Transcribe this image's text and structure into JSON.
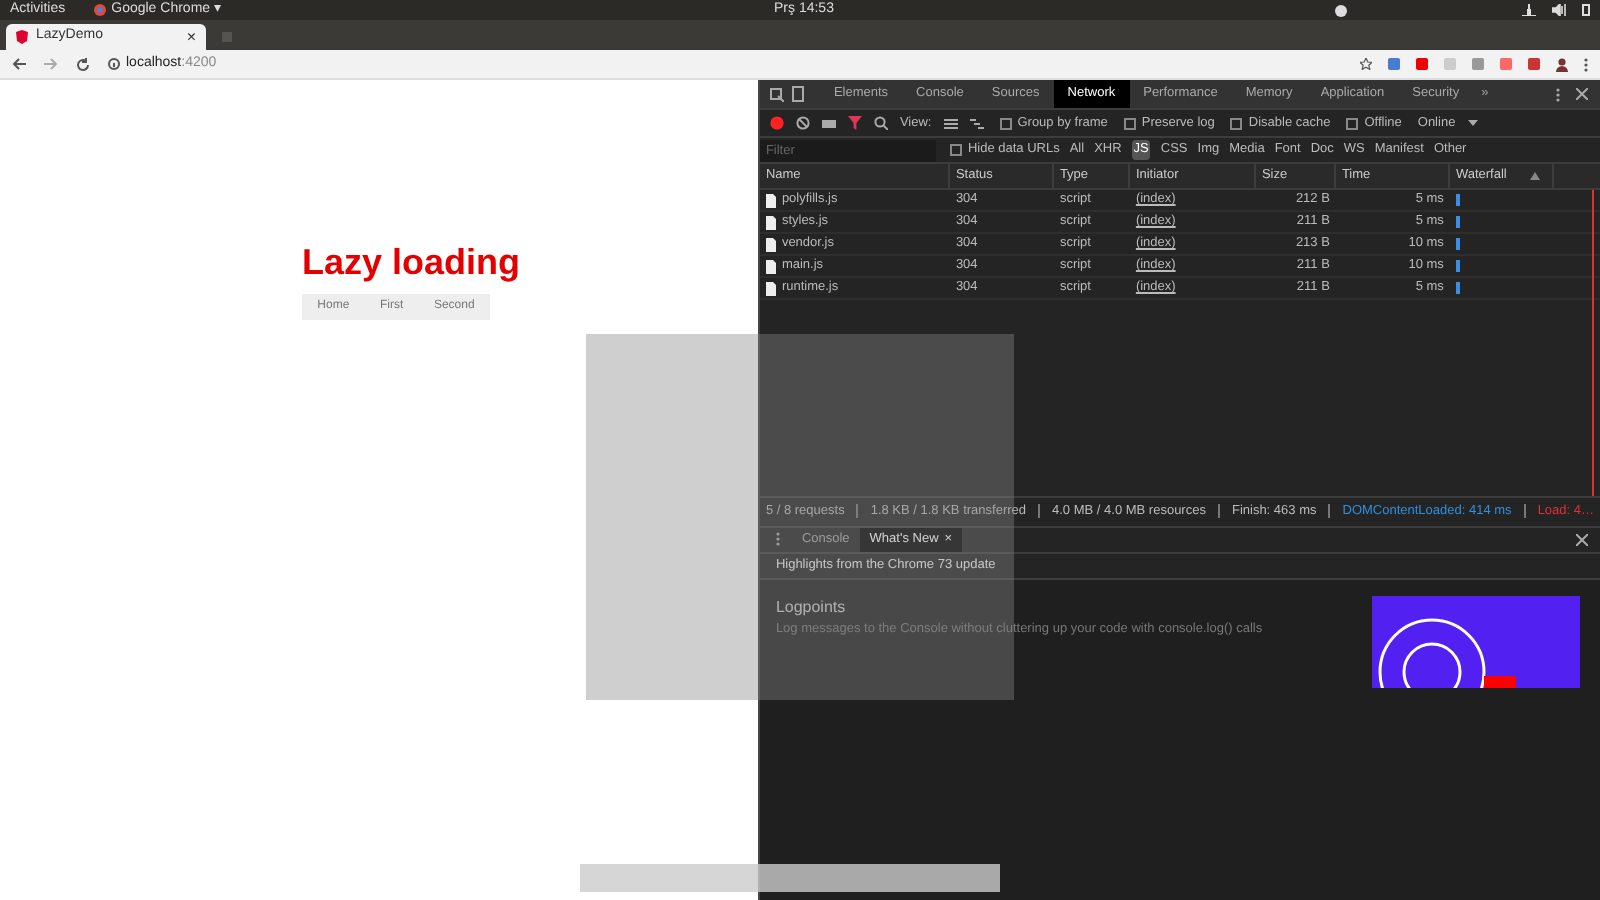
{
  "system_bar": {
    "activities": "Activities",
    "app": "Google Chrome ▾",
    "clock": "Prş 14:53"
  },
  "browser": {
    "tab": {
      "title": "LazyDemo",
      "close": "×"
    },
    "url": {
      "host": "localhost",
      "port": ":4200"
    }
  },
  "page": {
    "heading": "Lazy loading",
    "nav": [
      {
        "label": "Home"
      },
      {
        "label": "First"
      },
      {
        "label": "Second"
      }
    ]
  },
  "devtools": {
    "tabs": [
      {
        "label": "Elements",
        "selected": false
      },
      {
        "label": "Console",
        "selected": false
      },
      {
        "label": "Sources",
        "selected": false
      },
      {
        "label": "Network",
        "selected": true
      },
      {
        "label": "Performance",
        "selected": false
      },
      {
        "label": "Memory",
        "selected": false
      },
      {
        "label": "Application",
        "selected": false
      },
      {
        "label": "Security",
        "selected": false
      }
    ],
    "more": "»",
    "toolbar": {
      "recording": true,
      "view": "View:",
      "options": [
        {
          "label": "Group by frame",
          "checked": false
        },
        {
          "label": "Preserve log",
          "checked": false
        },
        {
          "label": "Disable cache",
          "checked": false
        },
        {
          "label": "Offline",
          "checked": false
        }
      ],
      "throttle": "Online"
    },
    "filter": {
      "placeholder": "Filter",
      "hide_data_urls": {
        "label": "Hide data URLs",
        "checked": false
      },
      "types": [
        {
          "label": "All",
          "selected": false
        },
        {
          "label": "XHR",
          "selected": false
        },
        {
          "label": "JS",
          "selected": true
        },
        {
          "label": "CSS",
          "selected": false
        },
        {
          "label": "Img",
          "selected": false
        },
        {
          "label": "Media",
          "selected": false
        },
        {
          "label": "Font",
          "selected": false
        },
        {
          "label": "Doc",
          "selected": false
        },
        {
          "label": "WS",
          "selected": false
        },
        {
          "label": "Manifest",
          "selected": false
        },
        {
          "label": "Other",
          "selected": false
        }
      ]
    },
    "table": {
      "columns": [
        "Name",
        "Status",
        "Type",
        "Initiator",
        "Size",
        "Time",
        "Waterfall"
      ],
      "rows": [
        {
          "name": "polyfills.js",
          "status": "304",
          "type": "script",
          "initiator": "(index)",
          "size": "212 B",
          "time": "5 ms"
        },
        {
          "name": "styles.js",
          "status": "304",
          "type": "script",
          "initiator": "(index)",
          "size": "211 B",
          "time": "5 ms"
        },
        {
          "name": "vendor.js",
          "status": "304",
          "type": "script",
          "initiator": "(index)",
          "size": "213 B",
          "time": "10 ms"
        },
        {
          "name": "main.js",
          "status": "304",
          "type": "script",
          "initiator": "(index)",
          "size": "211 B",
          "time": "10 ms"
        },
        {
          "name": "runtime.js",
          "status": "304",
          "type": "script",
          "initiator": "(index)",
          "size": "211 B",
          "time": "5 ms"
        }
      ]
    },
    "status_bar": [
      {
        "text": "5 / 8 requests",
        "kind": "plain"
      },
      {
        "text": "1.8 KB / 1.8 KB transferred",
        "kind": "plain"
      },
      {
        "text": "4.0 MB / 4.0 MB resources",
        "kind": "plain"
      },
      {
        "text": "Finish: 463 ms",
        "kind": "plain"
      },
      {
        "text": "DOMContentLoaded: 414 ms",
        "kind": "dom"
      },
      {
        "text": "Load: 4…",
        "kind": "load"
      }
    ],
    "drawer": {
      "tabs": [
        {
          "label": "Console",
          "selected": false
        },
        {
          "label": "What's New",
          "selected": true
        }
      ],
      "tab_close": "×",
      "heading": "Highlights from the Chrome 73 update",
      "items": [
        {
          "title": "Logpoints",
          "text": "Log messages to the Console without cluttering up your code with console.log() calls"
        }
      ]
    }
  }
}
